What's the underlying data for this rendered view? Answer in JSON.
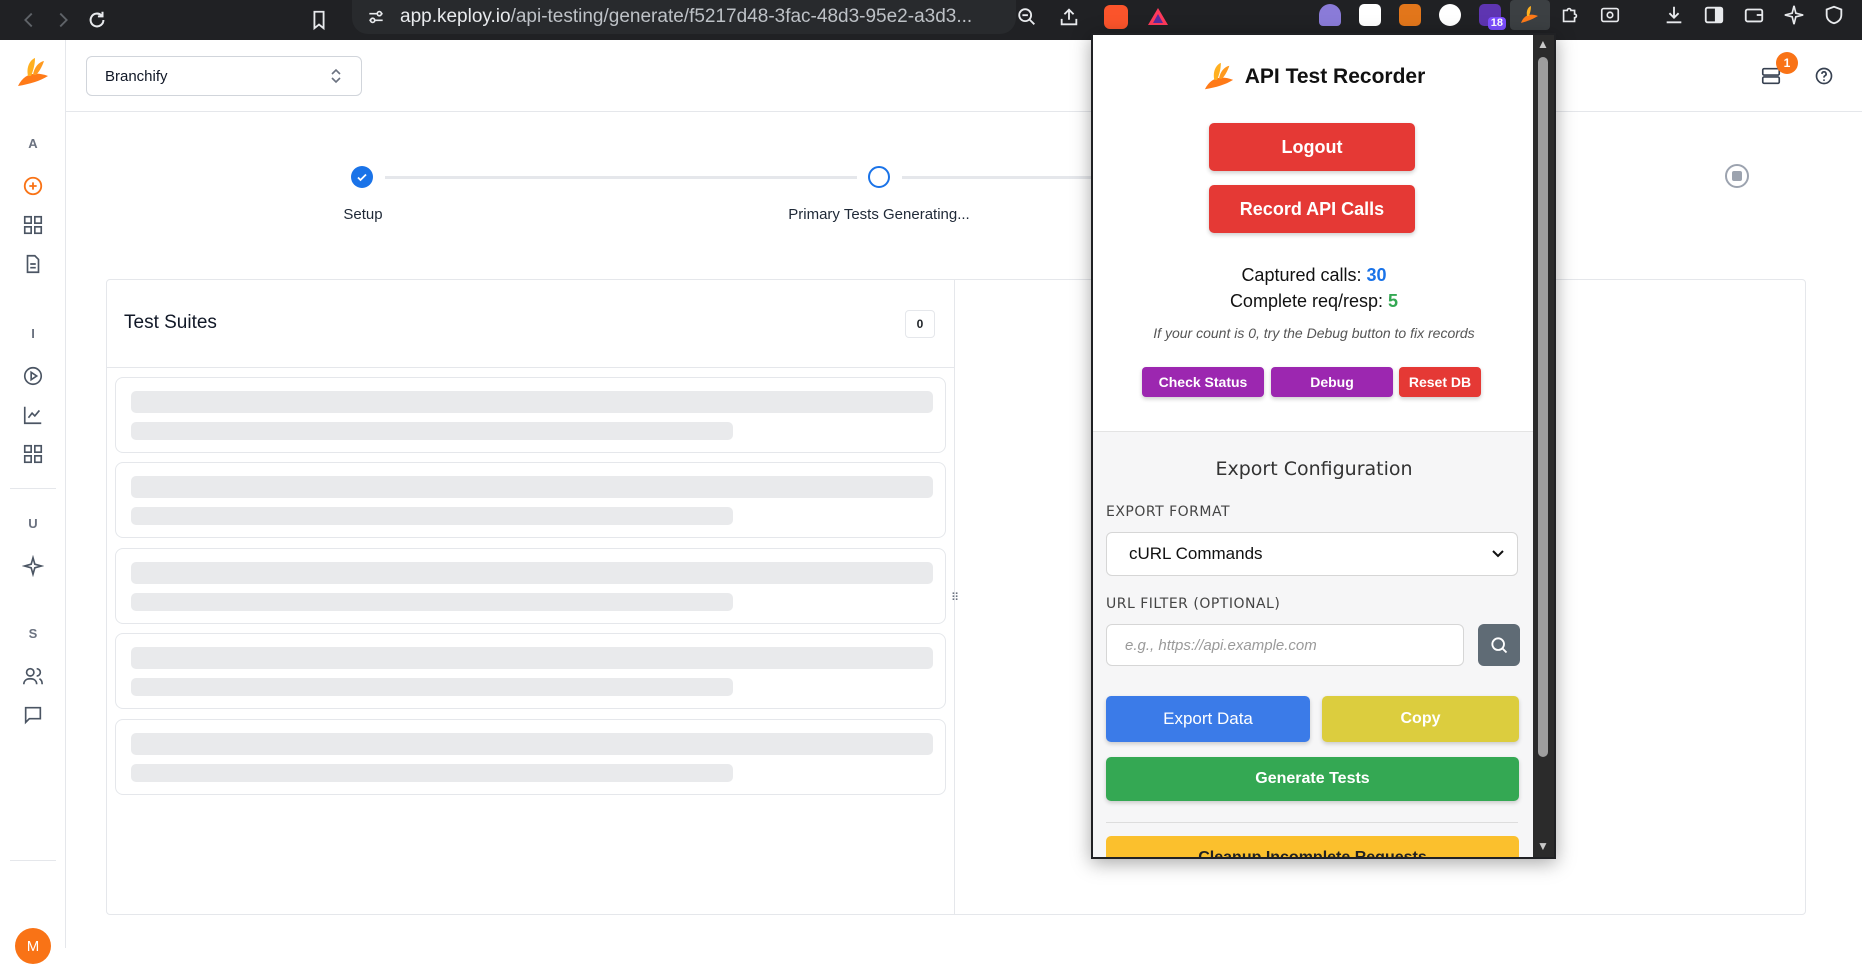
{
  "browser": {
    "url_host": "app.keploy.io",
    "url_path": "/api-testing/generate/f5217d48-3fac-48d3-95e2-a3d3...",
    "ext_badge": "18"
  },
  "app": {
    "branch_name": "Branchify",
    "notification_count": "1",
    "avatar_initial": "M",
    "sidebar_sections": [
      "A",
      "I",
      "U",
      "S"
    ]
  },
  "stepper": {
    "steps": [
      {
        "label": "Setup",
        "state": "done"
      },
      {
        "label": "Primary Tests Generating...",
        "state": "active"
      }
    ]
  },
  "suites": {
    "title": "Test Suites",
    "count": "0"
  },
  "popup": {
    "title": "API Test Recorder",
    "logout_label": "Logout",
    "record_label": "Record API Calls",
    "captured_label": "Captured calls:",
    "captured_value": "30",
    "complete_label": "Complete req/resp:",
    "complete_value": "5",
    "hint": "If your count is 0, try the Debug button to fix records",
    "check_status_label": "Check Status",
    "debug_label": "Debug",
    "reset_db_label": "Reset DB",
    "export": {
      "title": "Export Configuration",
      "format_label": "EXPORT FORMAT",
      "format_value": "cURL Commands",
      "filter_label": "URL FILTER (OPTIONAL)",
      "filter_placeholder": "e.g., https://api.example.com",
      "export_label": "Export Data",
      "copy_label": "Copy",
      "generate_label": "Generate Tests",
      "cleanup_label": "Cleanup Incomplete Requests"
    }
  },
  "colors": {
    "accent_orange": "#f97316",
    "blue": "#1a73e8",
    "red": "#e53935",
    "purple": "#9c27b0",
    "green": "#34a853",
    "yellow": "#dccd3e"
  }
}
